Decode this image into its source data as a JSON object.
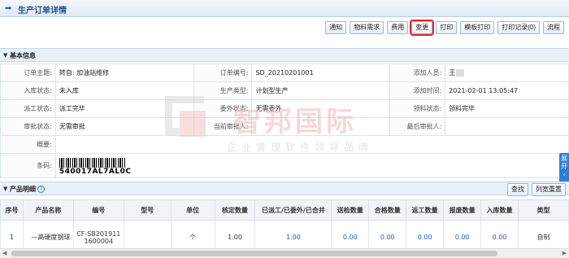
{
  "header": {
    "title": "生产订单详情"
  },
  "toolbar": [
    {
      "label": "通知"
    },
    {
      "label": "物料需求"
    },
    {
      "label": "费用"
    },
    {
      "label": "变更"
    },
    {
      "label": "打印"
    },
    {
      "label": "模板打印"
    },
    {
      "label": "打印记录(0)"
    },
    {
      "label": "流程"
    }
  ],
  "basic": {
    "section_title": "基本信息",
    "rows": [
      [
        {
          "l": "订单主题:",
          "v": "转自: 加油站维修"
        },
        {
          "l": "订单编号:",
          "v": "SD_20210201001"
        },
        {
          "l": "添加人员:",
          "v": "王"
        }
      ],
      [
        {
          "l": "入库状态:",
          "v": "未入库"
        },
        {
          "l": "生产类型:",
          "v": "计划型生产"
        },
        {
          "l": "添加时间:",
          "v": "2021-02-01 13:05:47"
        }
      ],
      [
        {
          "l": "派工状态:",
          "v": "派工完毕"
        },
        {
          "l": "委外状态:",
          "v": "无需委外"
        },
        {
          "l": "领料状态:",
          "v": "领料完毕"
        }
      ],
      [
        {
          "l": "审批状态:",
          "v": "无需审批"
        },
        {
          "l": "当前审批人:",
          "v": ""
        },
        {
          "l": "最后审批人:",
          "v": ""
        }
      ]
    ],
    "summary_label": "概要:",
    "summary_value": "",
    "barcode_label": "条码:",
    "barcode_value": "540017AL7AL0C"
  },
  "side_tab": "展开",
  "watermark": {
    "cn": "智邦国际",
    "sub": "企业管理软件领导品牌"
  },
  "products": {
    "section_title": "产品明细",
    "tools": [
      {
        "label": "查找"
      },
      {
        "label": "列宽重置"
      }
    ],
    "columns": [
      "序号",
      "产品名称",
      "编号",
      "型号",
      "单位",
      "核定数量",
      "已派工/已委外/已合并",
      "送检数量",
      "合格数量",
      "返工数量",
      "报废数量",
      "入库数量",
      "类型"
    ],
    "rows": [
      [
        "1",
        "—高硬度钢球",
        "CF-SB2019111600004",
        "",
        "个",
        "1.00",
        "1.00",
        "0.00",
        "0.00",
        "0.00",
        "0.00",
        "0.00",
        "自制"
      ]
    ]
  },
  "colors": {
    "accent": "#1d4f91",
    "highlight": "#e0262a"
  }
}
